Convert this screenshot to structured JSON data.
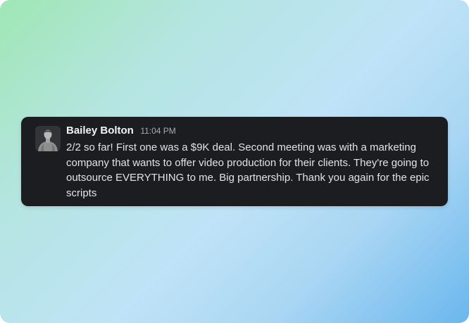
{
  "message": {
    "sender": "Bailey Bolton",
    "timestamp": "11:04 PM",
    "text": "2/2 so far! First one was a $9K deal. Second meeting was with a marketing company that wants to offer video production for their clients. They're going to outsource EVERYTHING to me. Big partnership. Thank you again for the epic scripts",
    "avatar": "user-avatar-photo"
  },
  "colors": {
    "card_background": "#1b1d21",
    "sender": "#f4f4f5",
    "timestamp": "#a8aab0",
    "text": "#e3e3e5",
    "gradient_start": "#9fe6b4",
    "gradient_end": "#6ab7ee"
  }
}
